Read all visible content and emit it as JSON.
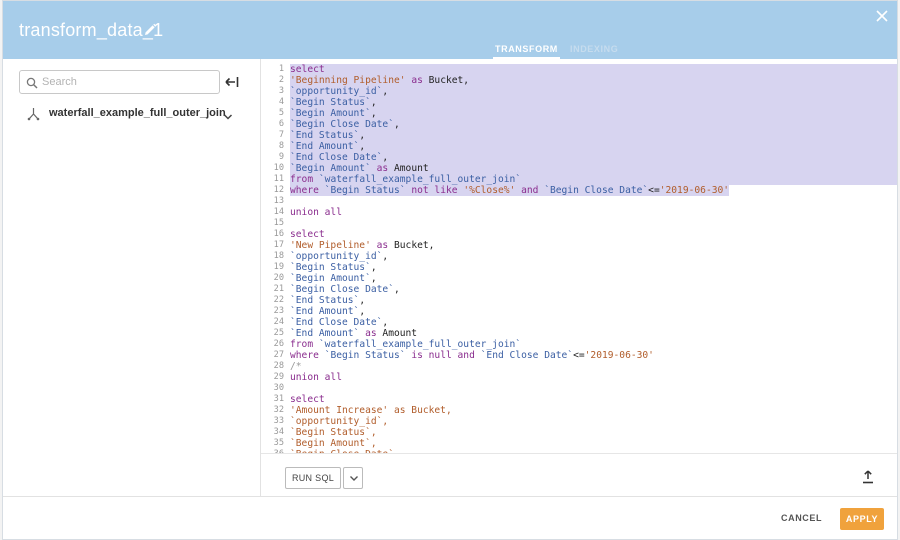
{
  "header": {
    "title": "transform_data_1",
    "tabs": [
      {
        "label": "TRANSFORM",
        "active": true
      },
      {
        "label": "INDEXING",
        "active": false
      }
    ],
    "background_color": "#a7cdea"
  },
  "sidebar": {
    "search": {
      "placeholder": "Search",
      "value": ""
    },
    "dataset": {
      "label": "waterfall_example_full_outer_join"
    }
  },
  "editor": {
    "selected_through_line": 12,
    "lines": [
      {
        "n": "1",
        "tokens": [
          {
            "t": "kw",
            "s": "select"
          }
        ]
      },
      {
        "n": "2",
        "tokens": [
          {
            "t": "str",
            "s": "'Beginning Pipeline'"
          },
          {
            "t": "plain",
            "s": " "
          },
          {
            "t": "kw",
            "s": "as"
          },
          {
            "t": "plain",
            "s": " Bucket,"
          }
        ]
      },
      {
        "n": "3",
        "tokens": [
          {
            "t": "bt",
            "s": "`opportunity_id`"
          },
          {
            "t": "plain",
            "s": ","
          }
        ]
      },
      {
        "n": "4",
        "tokens": [
          {
            "t": "bt",
            "s": "`Begin Status`"
          },
          {
            "t": "plain",
            "s": ","
          }
        ]
      },
      {
        "n": "5",
        "tokens": [
          {
            "t": "bt",
            "s": "`Begin Amount`"
          },
          {
            "t": "plain",
            "s": ","
          }
        ]
      },
      {
        "n": "6",
        "tokens": [
          {
            "t": "bt",
            "s": "`Begin Close Date`"
          },
          {
            "t": "plain",
            "s": ","
          }
        ]
      },
      {
        "n": "7",
        "tokens": [
          {
            "t": "bt",
            "s": "`End Status`"
          },
          {
            "t": "plain",
            "s": ","
          }
        ]
      },
      {
        "n": "8",
        "tokens": [
          {
            "t": "bt",
            "s": "`End Amount`"
          },
          {
            "t": "plain",
            "s": ","
          }
        ]
      },
      {
        "n": "9",
        "tokens": [
          {
            "t": "bt",
            "s": "`End Close Date`"
          },
          {
            "t": "plain",
            "s": ","
          }
        ]
      },
      {
        "n": "10",
        "tokens": [
          {
            "t": "bt",
            "s": "`Begin Amount`"
          },
          {
            "t": "plain",
            "s": " "
          },
          {
            "t": "kw",
            "s": "as"
          },
          {
            "t": "plain",
            "s": " Amount"
          }
        ]
      },
      {
        "n": "11",
        "tokens": [
          {
            "t": "kw",
            "s": "from"
          },
          {
            "t": "plain",
            "s": " "
          },
          {
            "t": "bt",
            "s": "`waterfall_example_full_outer_join`"
          }
        ]
      },
      {
        "n": "12",
        "tokens": [
          {
            "t": "kw",
            "s": "where"
          },
          {
            "t": "plain",
            "s": " "
          },
          {
            "t": "bt",
            "s": "`Begin Status`"
          },
          {
            "t": "plain",
            "s": " "
          },
          {
            "t": "kw",
            "s": "not like"
          },
          {
            "t": "plain",
            "s": " "
          },
          {
            "t": "str",
            "s": "'%Close%'"
          },
          {
            "t": "plain",
            "s": " "
          },
          {
            "t": "kw",
            "s": "and"
          },
          {
            "t": "plain",
            "s": " "
          },
          {
            "t": "bt",
            "s": "`Begin Close Date`"
          },
          {
            "t": "plain",
            "s": "<="
          },
          {
            "t": "str",
            "s": "'2019-06-30'"
          }
        ]
      },
      {
        "n": "13",
        "tokens": []
      },
      {
        "n": "14",
        "tokens": [
          {
            "t": "kw",
            "s": "union all"
          }
        ]
      },
      {
        "n": "15",
        "tokens": []
      },
      {
        "n": "16",
        "tokens": [
          {
            "t": "kw",
            "s": "select"
          }
        ]
      },
      {
        "n": "17",
        "tokens": [
          {
            "t": "str",
            "s": "'New Pipeline'"
          },
          {
            "t": "plain",
            "s": " "
          },
          {
            "t": "kw",
            "s": "as"
          },
          {
            "t": "plain",
            "s": " Bucket,"
          }
        ]
      },
      {
        "n": "18",
        "tokens": [
          {
            "t": "bt",
            "s": "`opportunity_id`"
          },
          {
            "t": "plain",
            "s": ","
          }
        ]
      },
      {
        "n": "19",
        "tokens": [
          {
            "t": "bt",
            "s": "`Begin Status`"
          },
          {
            "t": "plain",
            "s": ","
          }
        ]
      },
      {
        "n": "20",
        "tokens": [
          {
            "t": "bt",
            "s": "`Begin Amount`"
          },
          {
            "t": "plain",
            "s": ","
          }
        ]
      },
      {
        "n": "21",
        "tokens": [
          {
            "t": "bt",
            "s": "`Begin Close Date`"
          },
          {
            "t": "plain",
            "s": ","
          }
        ]
      },
      {
        "n": "22",
        "tokens": [
          {
            "t": "bt",
            "s": "`End Status`"
          },
          {
            "t": "plain",
            "s": ","
          }
        ]
      },
      {
        "n": "23",
        "tokens": [
          {
            "t": "bt",
            "s": "`End Amount`"
          },
          {
            "t": "plain",
            "s": ","
          }
        ]
      },
      {
        "n": "24",
        "tokens": [
          {
            "t": "bt",
            "s": "`End Close Date`"
          },
          {
            "t": "plain",
            "s": ","
          }
        ]
      },
      {
        "n": "25",
        "tokens": [
          {
            "t": "bt",
            "s": "`End Amount`"
          },
          {
            "t": "plain",
            "s": " "
          },
          {
            "t": "kw",
            "s": "as"
          },
          {
            "t": "plain",
            "s": " Amount"
          }
        ]
      },
      {
        "n": "26",
        "tokens": [
          {
            "t": "kw",
            "s": "from"
          },
          {
            "t": "plain",
            "s": " "
          },
          {
            "t": "bt",
            "s": "`waterfall_example_full_outer_join`"
          }
        ]
      },
      {
        "n": "27",
        "tokens": [
          {
            "t": "kw",
            "s": "where"
          },
          {
            "t": "plain",
            "s": " "
          },
          {
            "t": "bt",
            "s": "`Begin Status`"
          },
          {
            "t": "plain",
            "s": " "
          },
          {
            "t": "kw",
            "s": "is null and"
          },
          {
            "t": "plain",
            "s": " "
          },
          {
            "t": "bt",
            "s": "`End Close Date`"
          },
          {
            "t": "plain",
            "s": "<="
          },
          {
            "t": "str",
            "s": "'2019-06-30'"
          }
        ]
      },
      {
        "n": "28",
        "tokens": [
          {
            "t": "cmt",
            "s": "/*"
          }
        ]
      },
      {
        "n": "29",
        "tokens": [
          {
            "t": "kw",
            "s": "union all"
          }
        ]
      },
      {
        "n": "30",
        "tokens": []
      },
      {
        "n": "31",
        "tokens": [
          {
            "t": "kw",
            "s": "select"
          }
        ]
      },
      {
        "n": "32",
        "tokens": [
          {
            "t": "str",
            "s": "'Amount Increase' as Bucket,"
          }
        ]
      },
      {
        "n": "33",
        "tokens": [
          {
            "t": "str",
            "s": "`opportunity_id`,"
          }
        ]
      },
      {
        "n": "34",
        "tokens": [
          {
            "t": "str",
            "s": "`Begin Status`,"
          }
        ]
      },
      {
        "n": "35",
        "tokens": [
          {
            "t": "str",
            "s": "`Begin Amount`,"
          }
        ]
      },
      {
        "n": "36",
        "tokens": [
          {
            "t": "str",
            "s": "`Begin Close Date`,"
          }
        ]
      }
    ]
  },
  "toolbar": {
    "run_label": "RUN SQL"
  },
  "footer": {
    "cancel_label": "CANCEL",
    "apply_label": "APPLY",
    "apply_color": "#f0a23c"
  },
  "icons": [
    "edit-icon",
    "close-icon",
    "search-icon",
    "collapse-sidebar-icon",
    "dataset-join-icon",
    "chevron-down-icon",
    "export-icon"
  ]
}
